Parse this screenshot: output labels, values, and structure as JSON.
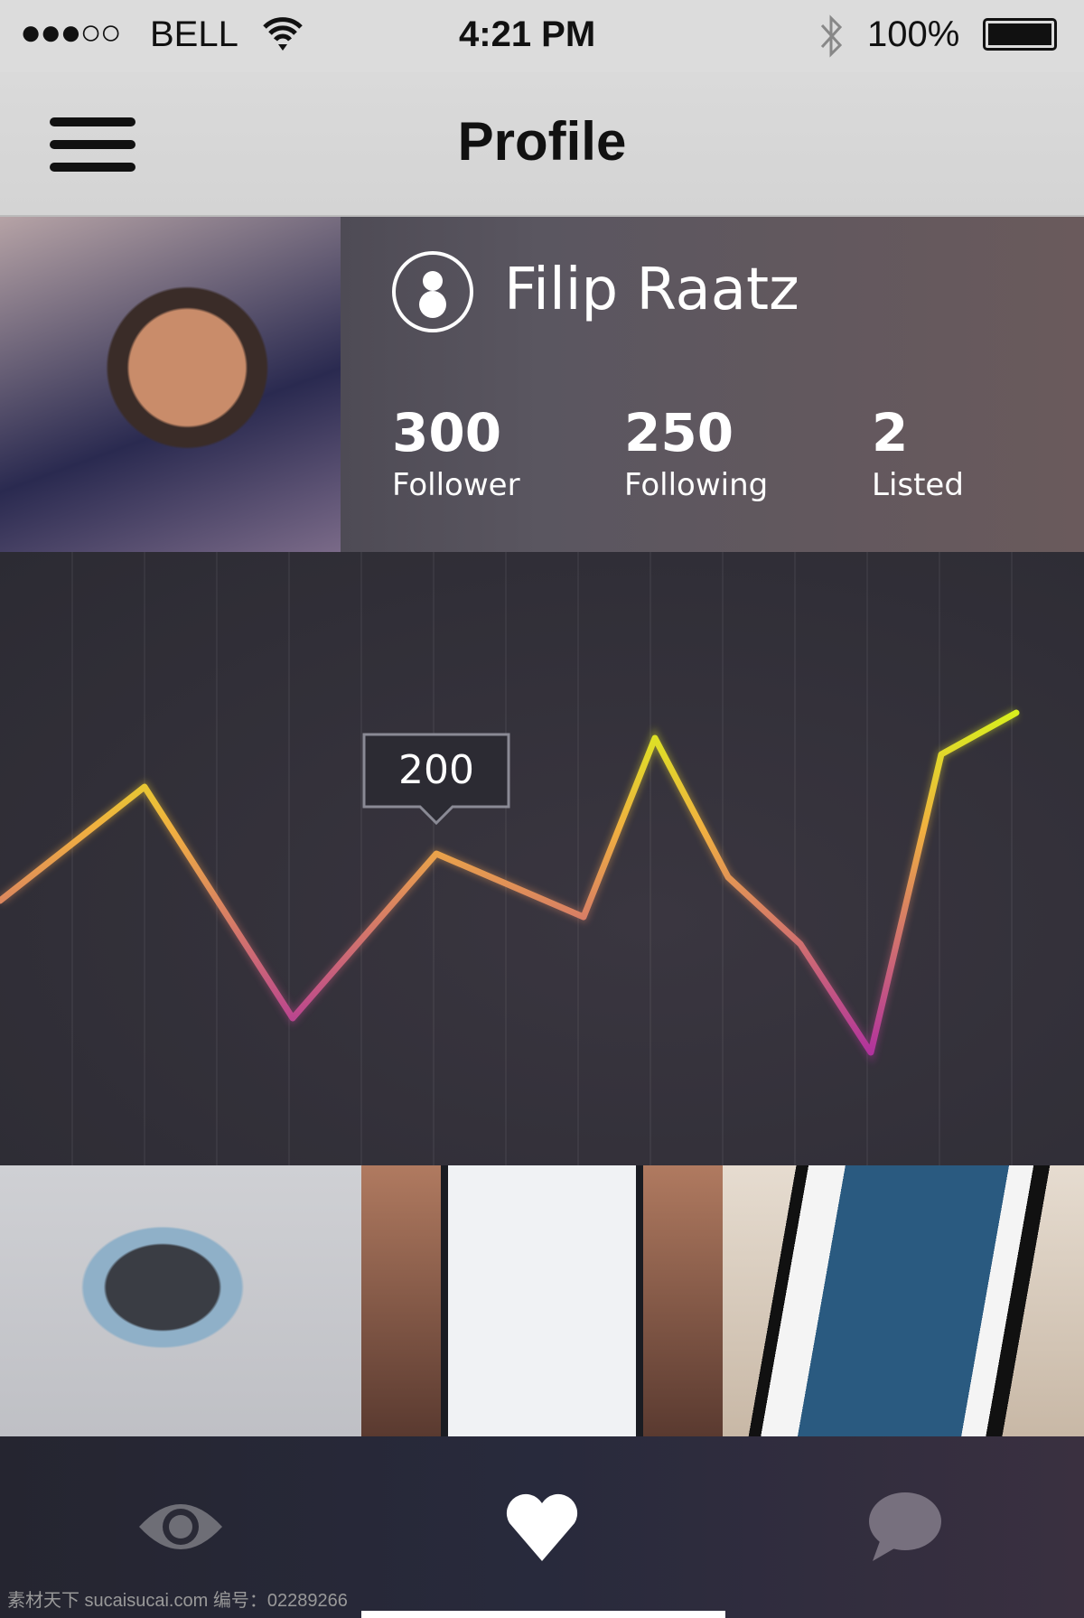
{
  "status_bar": {
    "carrier": "BELL",
    "signal": "●●●○○",
    "time": "4:21 PM",
    "battery": "100%",
    "icons": [
      "wifi-icon",
      "bluetooth-icon",
      "battery-icon"
    ]
  },
  "nav": {
    "title": "Profile",
    "menu_icon": "hamburger-icon"
  },
  "profile": {
    "name": "Filip Raatz",
    "stats": [
      {
        "value": "300",
        "label": "Follower"
      },
      {
        "value": "250",
        "label": "Following"
      },
      {
        "value": "2",
        "label": "Listed"
      }
    ]
  },
  "chart_data": {
    "type": "line",
    "values": [
      174,
      237,
      109,
      200,
      165,
      264,
      187,
      150,
      90,
      255,
      278
    ],
    "highlight_index": 3,
    "tooltip": "200",
    "grid": "vertical",
    "colors": [
      "#d6f21c",
      "#f0b040",
      "#b0309f"
    ]
  },
  "tabs": [
    {
      "icon": "eye-icon",
      "active": false
    },
    {
      "icon": "heart-icon",
      "active": true
    },
    {
      "icon": "chat-bubble-icon",
      "active": false
    }
  ],
  "watermark": "素材天下 sucaisucai.com  编号：02289266"
}
